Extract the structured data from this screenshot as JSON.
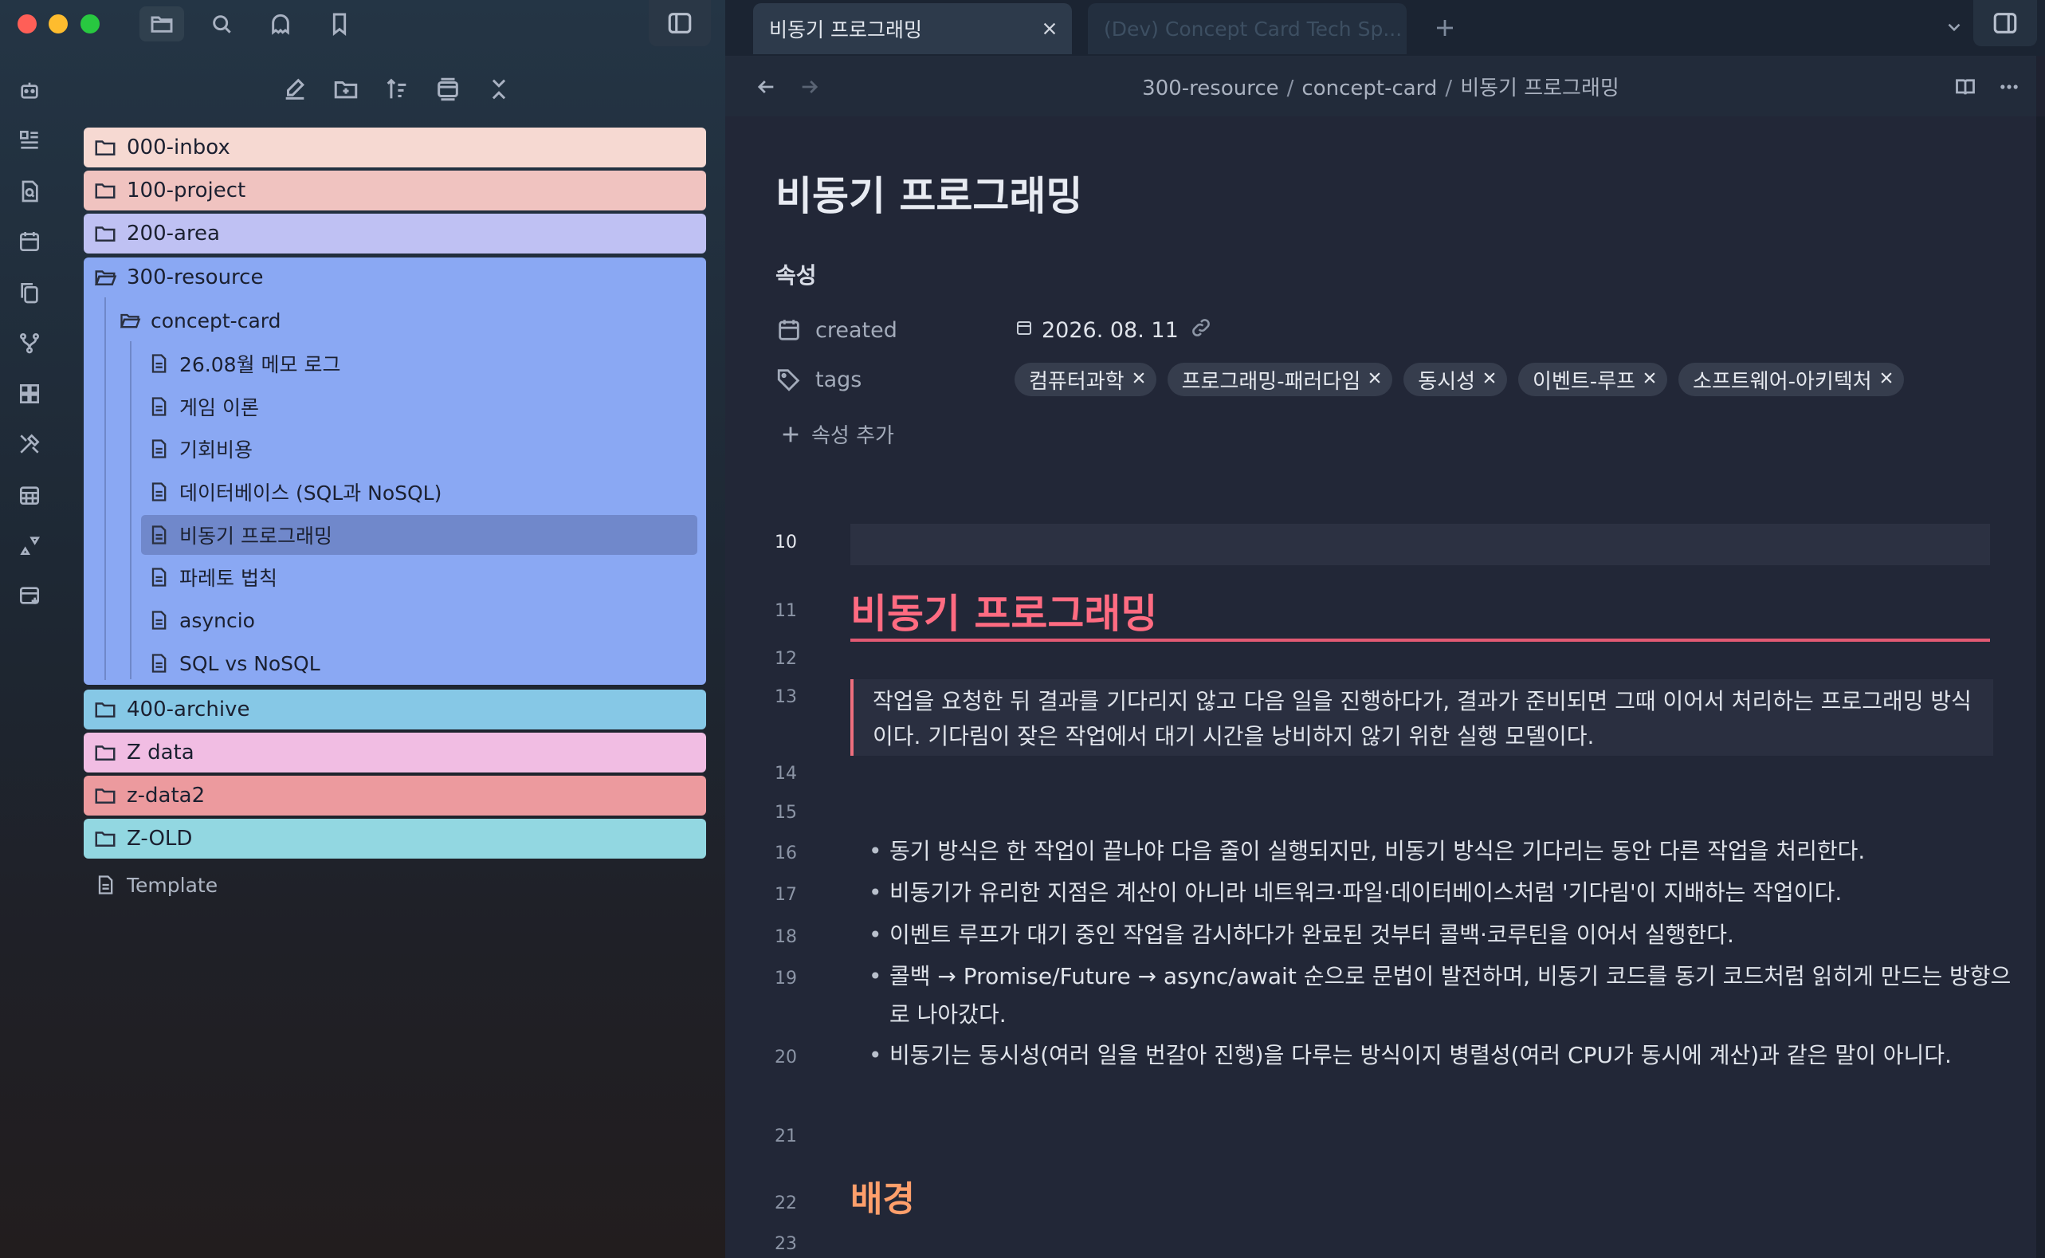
{
  "tabs": [
    {
      "label": "비동기 프로그래밍",
      "active": true
    },
    {
      "label": "(Dev) Concept Card Tech Sp...",
      "active": false
    }
  ],
  "breadcrumb": [
    "300-resource",
    "concept-card",
    "비동기 프로그래밍"
  ],
  "tree": {
    "folders_top": [
      {
        "label": "000-inbox",
        "color": "#f6d9d2"
      },
      {
        "label": "100-project",
        "color": "#f0c3c0"
      },
      {
        "label": "200-area",
        "color": "#bfc1f3"
      }
    ],
    "resource": {
      "label": "300-resource",
      "color": "#8aa8f3"
    },
    "concept_card": {
      "label": "concept-card"
    },
    "files": [
      "26.08월 메모 로그",
      "게임 이론",
      "기회비용",
      "데이터베이스 (SQL과 NoSQL)",
      "비동기 프로그래밍",
      "파레토 법칙",
      "asyncio",
      "SQL vs NoSQL"
    ],
    "folders_bottom": [
      {
        "label": "400-archive",
        "color": "#86c8e6"
      },
      {
        "label": "Z data",
        "color": "#f1bde3"
      },
      {
        "label": "z-data2",
        "color": "#ec9a9e"
      },
      {
        "label": "Z-OLD",
        "color": "#92d7e1"
      }
    ],
    "template": "Template"
  },
  "doc": {
    "title": "비동기 프로그래밍",
    "properties_heading": "속성",
    "created_key": "created",
    "created_value": "2026. 08. 11",
    "tags_key": "tags",
    "tags": [
      "컴퓨터과학",
      "프로그래밍-패러다임",
      "동시성",
      "이벤트-루프",
      "소프트웨어-아키텍처"
    ],
    "add_property": "속성 추가"
  },
  "lines": {
    "numbers": [
      "10",
      "11",
      "12",
      "13",
      "14",
      "15",
      "16",
      "17",
      "18",
      "19",
      "20",
      "21",
      "22",
      "23"
    ],
    "h1": "비동기 프로그래밍",
    "quote": "작업을 요청한 뒤 결과를 기다리지 않고 다음 일을 진행하다가, 결과가 준비되면 그때 이어서 처리하는 프로그래밍 방식이다. 기다림이 잦은 작업에서 대기 시간을 낭비하지 않기 위한 실행 모델이다.",
    "bullets": [
      "동기 방식은 한 작업이 끝나야 다음 줄이 실행되지만, 비동기 방식은 기다리는 동안 다른 작업을 처리한다.",
      "비동기가 유리한 지점은 계산이 아니라 네트워크·파일·데이터베이스처럼 '기다림'이 지배하는 작업이다.",
      "이벤트 루프가 대기 중인 작업을 감시하다가 완료된 것부터 콜백·코루틴을 이어서 실행한다.",
      "콜백 → Promise/Future → async/await 순으로 문법이 발전하며, 비동기 코드를 동기 코드처럼 읽히게 만드는 방향으로 나아갔다.",
      "비동기는 동시성(여러 일을 번갈아 진행)을 다루는 방식이지 병렬성(여러 CPU가 동시에 계산)과 같은 말이 아니다."
    ],
    "h2": "배경"
  },
  "colors": {
    "h1": "#ff6b81",
    "h2": "#ff9f6b",
    "accent_rule": "#e25a73"
  }
}
